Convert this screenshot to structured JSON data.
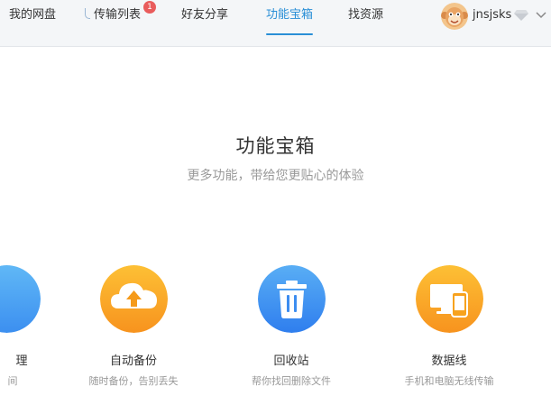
{
  "nav": {
    "items": [
      {
        "label": "我的网盘"
      },
      {
        "label": "传输列表",
        "badge": "1"
      },
      {
        "label": "好友分享"
      },
      {
        "label": "功能宝箱",
        "active": true
      },
      {
        "label": "找资源"
      }
    ]
  },
  "user": {
    "name": "jnsjsks",
    "avatar_icon": "monkey-avatar-icon",
    "vip_icon": "diamond-icon",
    "menu_icon": "chevron-down-icon"
  },
  "main": {
    "title": "功能宝箱",
    "subtitle": "更多功能，带给您更贴心的体验"
  },
  "tools": [
    {
      "name": "理",
      "desc": "间",
      "icon": "blue-circle-icon",
      "color": "#4aa6f0"
    },
    {
      "name": "自动备份",
      "desc": "随时备份，告别丢失",
      "icon": "cloud-upload-icon",
      "color": "#fbaa1a"
    },
    {
      "name": "回收站",
      "desc": "帮你找回删除文件",
      "icon": "trash-icon",
      "color": "#3d8df0"
    },
    {
      "name": "数据线",
      "desc": "手机和电脑无线传输",
      "icon": "devices-icon",
      "color": "#fbaa1a"
    }
  ],
  "colors": {
    "accent": "#2a8fd6",
    "badge": "#e95c5c",
    "topbar_bg": "#f4f6f8"
  }
}
